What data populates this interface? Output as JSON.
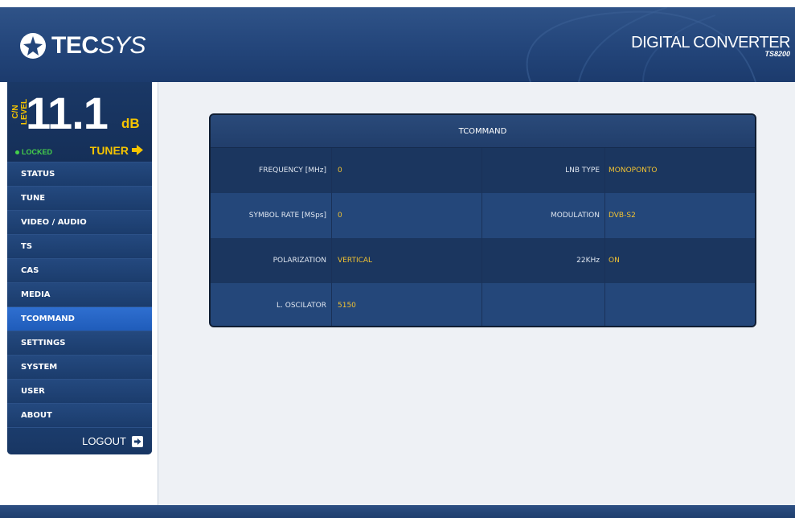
{
  "header": {
    "logo_text_bold": "TEC",
    "logo_text_light": "SYS",
    "product_title": "DIGITAL CONVERTER",
    "product_model": "TS8200"
  },
  "level": {
    "label": "C/N LEVEL",
    "value": "11.1",
    "unit": "dB",
    "status": "LOCKED",
    "tuner_label": "TUNER"
  },
  "menu": {
    "items": [
      {
        "label": "STATUS"
      },
      {
        "label": "TUNE"
      },
      {
        "label": "VIDEO / AUDIO"
      },
      {
        "label": "TS"
      },
      {
        "label": "CAS"
      },
      {
        "label": "MEDIA"
      },
      {
        "label": "TCOMMAND",
        "active": true
      },
      {
        "label": "SETTINGS"
      },
      {
        "label": "SYSTEM"
      },
      {
        "label": "USER"
      },
      {
        "label": "ABOUT"
      }
    ],
    "logout_label": "LOGOUT"
  },
  "panel": {
    "title": "TCOMMAND",
    "rows": [
      {
        "label1": "FREQUENCY [MHz]",
        "value1": "0",
        "label2": "LNB TYPE",
        "value2": "MONOPONTO"
      },
      {
        "label1": "SYMBOL RATE [MSps]",
        "value1": "0",
        "label2": "MODULATION",
        "value2": "DVB-S2"
      },
      {
        "label1": "POLARIZATION",
        "value1": "VERTICAL",
        "label2": "22KHz",
        "value2": "ON"
      },
      {
        "label1": "L. OSCILATOR",
        "value1": "5150",
        "label2": "",
        "value2": ""
      }
    ]
  },
  "colors": {
    "accent_yellow": "#f1c232",
    "locked_green": "#45d04a",
    "active_menu": "#2f6fd0",
    "panel_bg": "#1e3a66"
  }
}
